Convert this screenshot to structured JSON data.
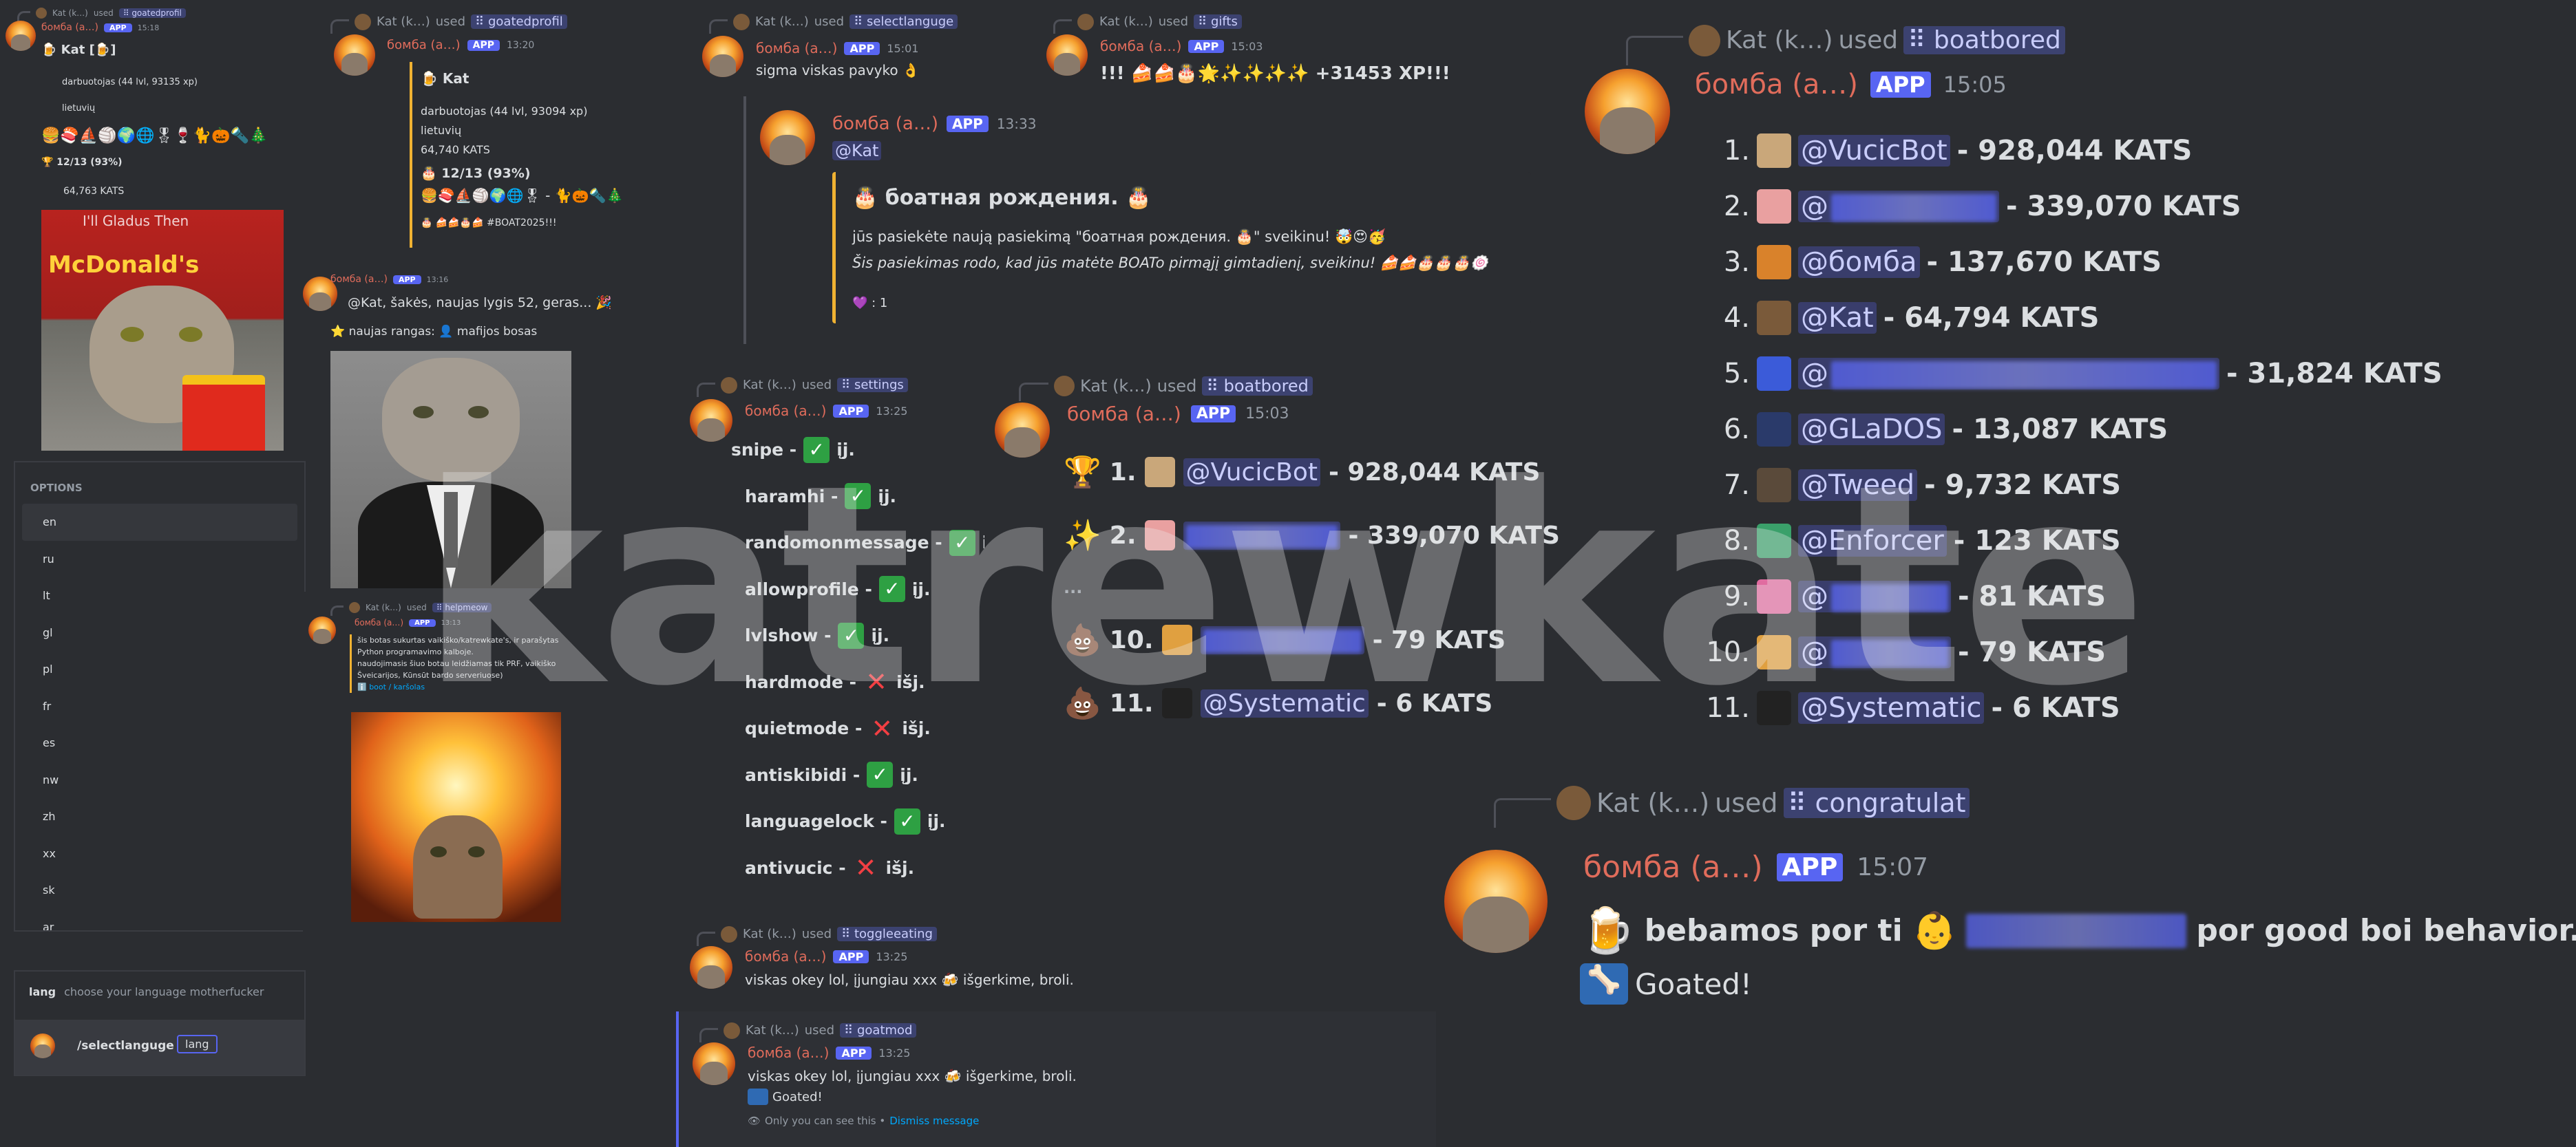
{
  "leaderboard_main": {
    "user": "Kat (k…)",
    "used_label": "used",
    "command": "boatbored",
    "bot_name": "бомба (a…)",
    "app_badge": "APP",
    "time": "15:05",
    "entries": [
      {
        "rank": "1.",
        "mention": "@VucicBot",
        "value": "- 928,044 KATS",
        "avatar_color": "#c9a77a"
      },
      {
        "rank": "2.",
        "mention": "@",
        "value": "- 339,070 KATS",
        "avatar_color": "#e9a0a0"
      },
      {
        "rank": "3.",
        "mention": "@бомба",
        "value": "- 137,670 KATS",
        "avatar_color": "#d9822b"
      },
      {
        "rank": "4.",
        "mention": "@Kat",
        "value": "- 64,794 KATS",
        "avatar_color": "#7a5a3a"
      },
      {
        "rank": "5.",
        "mention": "@",
        "value": "- 31,824 KATS",
        "avatar_color": "#3b5bd9"
      },
      {
        "rank": "6.",
        "mention": "@GLaDOS",
        "value": "- 13,087 KATS",
        "avatar_color": "#2a3a6a"
      },
      {
        "rank": "7.",
        "mention": "@Tweed",
        "value": "- 9,732 KATS",
        "avatar_color": "#5a4a3a"
      },
      {
        "rank": "8.",
        "mention": "@Enforcer",
        "value": "- 123 KATS",
        "avatar_color": "#3aa06a"
      },
      {
        "rank": "9.",
        "mention": "@",
        "value": "- 81 KATS",
        "avatar_color": "#e06ca0"
      },
      {
        "rank": "10.",
        "mention": "@",
        "value": "- 79 KATS",
        "avatar_color": "#e0a040"
      },
      {
        "rank": "11.",
        "mention": "@Systematic",
        "value": "- 6 KATS",
        "avatar_color": "#222222"
      }
    ]
  },
  "congrats": {
    "user": "Kat (k…)",
    "used_label": "used",
    "command": "congratulat",
    "bot_name": "бомба (a…)",
    "app_badge": "APP",
    "time": "15:07",
    "text_before": "bebamos por ti",
    "text_after": "por good boi behavior.",
    "goated": "Goated!"
  },
  "leaderboard_mid": {
    "user": "Kat (k…)",
    "used_label": "used",
    "command": "boatbored",
    "bot_name": "бомба (a…)",
    "app_badge": "APP",
    "time": "15:03",
    "entries": [
      {
        "rank": "1.",
        "mention": "@VucicBot",
        "value": "- 928,044 KATS",
        "icon": "🏆"
      },
      {
        "rank": "2.",
        "mention": "",
        "value": "- 339,070 KATS",
        "icon": "✨"
      },
      {
        "rank": "10.",
        "mention": "",
        "value": "- 79 KATS",
        "icon": "💩"
      },
      {
        "rank": "11.",
        "mention": "@Systematic",
        "value": "- 6 KATS",
        "icon": "💩"
      }
    ],
    "ellipsis": "..."
  },
  "settings": {
    "user": "Kat (k…)",
    "used_label": "used",
    "command": "settings",
    "bot_name": "бомба (a…)",
    "app_badge": "APP",
    "time": "13:25",
    "rows": [
      {
        "name": "snipe -",
        "state": "on",
        "label": "įj."
      },
      {
        "name": "haramhi -",
        "state": "on",
        "label": "įj."
      },
      {
        "name": "randomonmessage -",
        "state": "on",
        "label": "įj."
      },
      {
        "name": "allowprofile -",
        "state": "on",
        "label": "įj."
      },
      {
        "name": "lvlshow -",
        "state": "on",
        "label": "įj."
      },
      {
        "name": "hardmode -",
        "state": "off",
        "label": "išj."
      },
      {
        "name": "quietmode -",
        "state": "off",
        "label": "išj."
      },
      {
        "name": "antiskibidi -",
        "state": "on",
        "label": "įj."
      },
      {
        "name": "languagelock -",
        "state": "on",
        "label": "įj."
      },
      {
        "name": "antivucic -",
        "state": "off",
        "label": "išj."
      }
    ]
  },
  "toggleeating": {
    "user": "Kat (k…)",
    "used_label": "used",
    "command": "toggleeating",
    "bot_name": "бомба (a…)",
    "app_badge": "APP",
    "time": "13:25",
    "text": "viskas okey lol, įjungiau xxx 🍻 išgerkime, broli."
  },
  "goatmod": {
    "user": "Kat (k…)",
    "used_label": "used",
    "command": "goatmod",
    "bot_name": "бомба (a…)",
    "app_badge": "APP",
    "time": "13:25",
    "text": "viskas okey lol, įjungiau xxx 🍻 išgerkime, broli.",
    "goated": "Goated!",
    "ephemeral": "Only you can see this •",
    "dismiss": "Dismiss message"
  },
  "birthday": {
    "reply_user": "Kat (k…)",
    "used_label": "used",
    "command": "selectlanguge",
    "bot_name": "бомба (a…)",
    "app_badge": "APP",
    "time1": "15:01",
    "msg1": "sigma viskas pavyko 👌",
    "time2": "13:33",
    "mention": "@Kat",
    "embed_title": "🎂 боатная рождения. 🎂",
    "embed_line1": "jūs pasiekėte naują pasiekimą \"боатная рождения. 🎂\" sveikinu! 🤯😍🥳",
    "embed_line2": "Šis pasiekimas rodo, kad jūs matėte BOATo pirmąjį gimtadienį, sveikinu! 🍰🍰🎂🎂🎂🍥",
    "reaction": "💜 : 1"
  },
  "gifts": {
    "user": "Kat (k…)",
    "used_label": "used",
    "command": "gifts",
    "bot_name": "бомба (a…)",
    "app_badge": "APP",
    "time": "15:03",
    "text": "!!! 🍰🍰🎂🌟✨✨✨✨ +31453 XP!!!"
  },
  "profile_left": {
    "user": "Kat (k…)",
    "used_label": "used",
    "command": "goatedprofil",
    "bot_name": "бомба (a…)",
    "app_badge": "APP",
    "time": "15:18",
    "title": "🍺 Kat [🍺]",
    "job": "darbuotojas (44 lvl, 93135 xp)",
    "country": "lietuvių",
    "badges": "🍔🍣⛵🏐🌍🌐🎖🍷🐈🎃🔦🎄",
    "percent": "🏆 12/13 (93%)",
    "kats": "64,763 KATS"
  },
  "profile_mid": {
    "user": "Kat (k…)",
    "used_label": "used",
    "command": "goatedprofil",
    "bot_name": "бомба (a…)",
    "app_badge": "APP",
    "time": "13:20",
    "title": "🍺 Kat",
    "job": "darbuotojas (44 lvl, 93094 xp)",
    "country": "lietuvių",
    "kats": "64,740 KATS",
    "percent": "🎂 12/13 (93%)",
    "badges": "🍔🍣⛵🏐🌍🌐🎖 - 🐈🎃🔦🎄",
    "footer": "🎂 🍰🍰🎂🍰 #BOAT2025!!!"
  },
  "levelup": {
    "bot_name": "бомба (a…)",
    "app_badge": "APP",
    "time": "13:16",
    "text": "@Kat, šakės, naujas lygis 52, geras... 🎉",
    "rank": "⭐ naujas rangas: 👤 mafijos bosas"
  },
  "language_select": {
    "options_label": "OPTIONS",
    "options": [
      "en",
      "ru",
      "lt",
      "gl",
      "pl",
      "fr",
      "es",
      "nw",
      "zh",
      "xx",
      "sk",
      "ar"
    ],
    "option_arg": "lang",
    "option_desc": "choose your language motherfucker",
    "command": "/selectlanguge",
    "arg_value": "lang"
  },
  "explosion_msg": {
    "user": "Kat (k…)",
    "used_label": "used",
    "command": "helpmeow",
    "bot_name": "бомба (a…)",
    "app_badge": "APP",
    "time": "13:13",
    "line1": "šis botas sukurtas vaikiško/katrewkate's, ir parašytas",
    "line2": "Python programavimo kalboje.",
    "line3": "naudojimasis šiuo botau leidžiamas tik PRF, vaikiško",
    "line4": "Šveicarijos, Kūnsūt bardo serveriuose)",
    "links": "ℹ️ boot / karšolas"
  },
  "meme_caption": "I'll Gladus Then",
  "mcd_text": "McDonald's",
  "watermark": "katrewkate",
  "colors": {
    "bg": "#2b2d31",
    "panel": "#313338",
    "blurple": "#5865f2",
    "name": "#e06c5b",
    "muted": "#949ba4",
    "embed_border": "#f0b232"
  }
}
